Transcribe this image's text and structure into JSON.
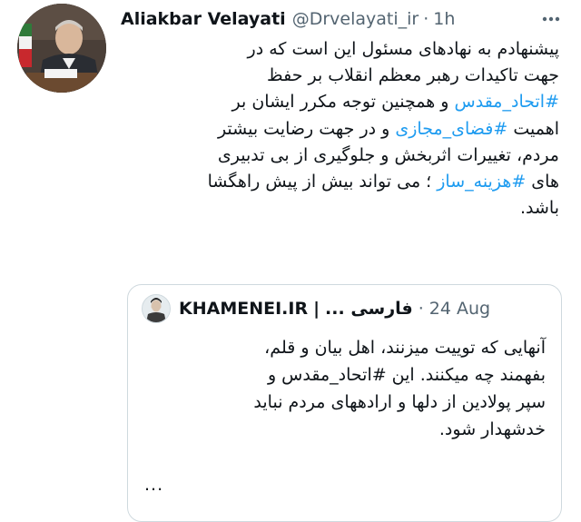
{
  "tweet": {
    "author_name": "Aliakbar Velayati",
    "handle": "@Drvelayati_ir",
    "separator": "·",
    "time": "1h",
    "more_icon": "more-horizontal-icon",
    "lines": [
      [
        {
          "t": "پیشنهادم به نهادهای مسئول این است که در"
        }
      ],
      [
        {
          "t": "جهت تاکیدات رهبر معظم انقلاب بر حفظ"
        }
      ],
      [
        {
          "t": "#اتحاد_مقدس",
          "tag": true
        },
        {
          "t": " و همچنین توجه مکرر ایشان بر"
        }
      ],
      [
        {
          "t": "اهمیت "
        },
        {
          "t": "#فضای_مجازی",
          "tag": true
        },
        {
          "t": " و در جهت رضایت بیشتر"
        }
      ],
      [
        {
          "t": "مردم، تغییرات اثربخش و جلوگیری از بی تدبیری"
        }
      ],
      [
        {
          "t": "های "
        },
        {
          "t": "#هزینه_ساز",
          "tag": true
        },
        {
          "t": " ؛ می تواند بیش از پیش راهگشا"
        }
      ],
      [
        {
          "t": "باشد."
        }
      ]
    ]
  },
  "quote": {
    "author_name": "KHAMENEI.IR",
    "name_separator": "|",
    "author_name_fa": "فارسی ...",
    "separator": "·",
    "date": "24 Aug",
    "lines": [
      "آنهایی که توییت میزنند، اهل بیان و قلم،",
      "بفهمند چه میکنند. این #اتحاد_مقدس و",
      "سپر پولادین از دلها و ارادههای مردم نباید",
      "خدشهدار شود."
    ],
    "ellipsis": "..."
  },
  "colors": {
    "text": "#0f1419",
    "secondary": "#536471",
    "link": "#1d9bf0",
    "border": "#cfd9de"
  }
}
